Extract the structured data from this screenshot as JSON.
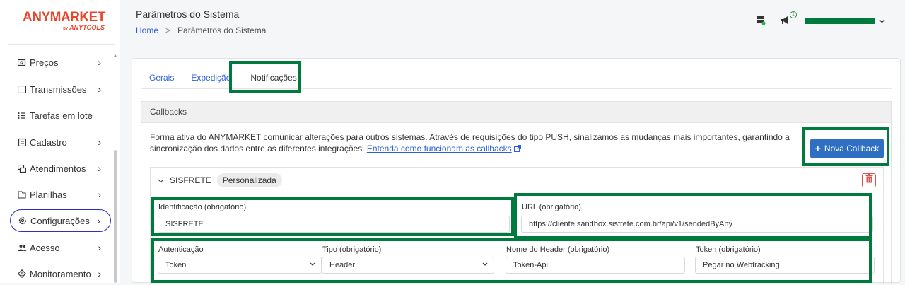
{
  "brand": {
    "name": "ANYMARKET",
    "by": "BY",
    "sub": "ANYTOOLS"
  },
  "sidebar": {
    "items": [
      {
        "label": "Preços",
        "icon": "price-tag-icon",
        "has_chevron": true
      },
      {
        "label": "Transmissões",
        "icon": "transmissions-icon",
        "has_chevron": true
      },
      {
        "label": "Tarefas em lote",
        "icon": "list-icon",
        "has_chevron": false
      },
      {
        "label": "Cadastro",
        "icon": "clipboard-icon",
        "has_chevron": true
      },
      {
        "label": "Atendimentos",
        "icon": "chat-icon",
        "has_chevron": true
      },
      {
        "label": "Planilhas",
        "icon": "spreadsheet-icon",
        "has_chevron": true
      },
      {
        "label": "Configurações",
        "icon": "gear-icon",
        "has_chevron": true,
        "active": true
      },
      {
        "label": "Acesso",
        "icon": "users-icon",
        "has_chevron": true
      },
      {
        "label": "Monitoramento",
        "icon": "monitor-icon",
        "has_chevron": true
      }
    ],
    "chevron": "›"
  },
  "header": {
    "title": "Parâmetros do Sistema",
    "breadcrumb": {
      "home": "Home",
      "separator": ">",
      "current": "Parâmetros do Sistema"
    },
    "notification_count": "1"
  },
  "tabs": [
    {
      "label": "Gerais"
    },
    {
      "label": "Expedição"
    },
    {
      "label": "Notificações",
      "active": true
    }
  ],
  "callbacks": {
    "title": "Callbacks",
    "description": "Forma ativa do ANYMARKET comunicar alterações para outros sistemas. Através de requisições do tipo PUSH, sinalizamos as mudanças mais importantes, garantindo a sincronização dos dados entre as diferentes integrações.",
    "link_text": "Entenda como funcionam as callbacks",
    "new_button": "Nova Callback",
    "item": {
      "name": "SISFRETE",
      "tag": "Personalizada",
      "fields": {
        "identificacao": {
          "label": "Identificação (obrigatório)",
          "value": "SISFRETE"
        },
        "url": {
          "label": "URL (obrigatório)",
          "value": "https://cliente.sandbox.sisfrete.com.br/api/v1/sendedByAny"
        },
        "autenticacao": {
          "label": "Autenticação",
          "value": "Token"
        },
        "tipo": {
          "label": "Tipo (obrigatório)",
          "value": "Header"
        },
        "header_name": {
          "label": "Nome do Header (obrigatório)",
          "value": "Token-Api"
        },
        "token": {
          "label": "Token (obrigatório)",
          "value": "Pegar no Webtracking"
        }
      }
    }
  },
  "colors": {
    "brand": "#e8452c",
    "highlight": "#007a3d",
    "link": "#2d5fd8",
    "primary_button": "#2f6fc1",
    "active_nav_border": "#2d2fbf"
  }
}
